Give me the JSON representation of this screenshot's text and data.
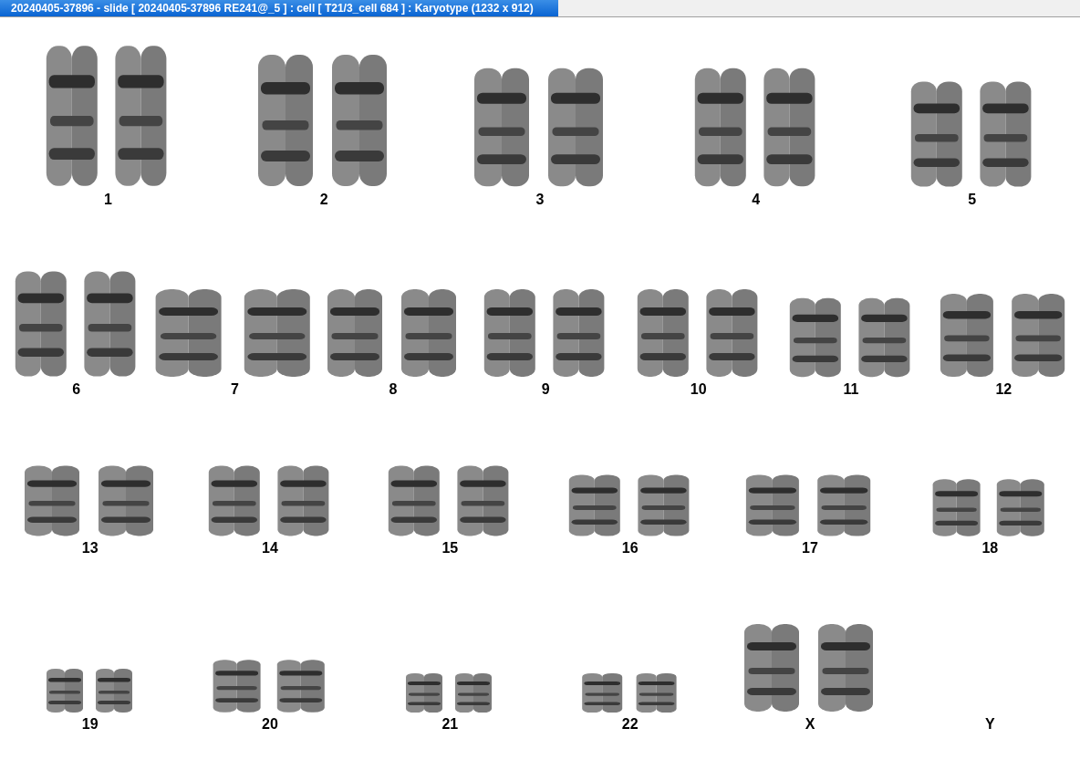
{
  "window": {
    "title": "20240405-37896 - slide [ 20240405-37896 RE241@_5 ] : cell [ T21/3_cell 684 ] : Karyotype  (1232 x 912)"
  },
  "karyotype_rows": [
    {
      "chromosomes": [
        {
          "label": "1",
          "kind": "pair"
        },
        {
          "label": "2",
          "kind": "pair"
        },
        {
          "label": "3",
          "kind": "pair"
        },
        {
          "label": "4",
          "kind": "pair"
        },
        {
          "label": "5",
          "kind": "pair"
        }
      ]
    },
    {
      "chromosomes": [
        {
          "label": "6",
          "kind": "pair"
        },
        {
          "label": "7",
          "kind": "pair"
        },
        {
          "label": "8",
          "kind": "pair"
        },
        {
          "label": "9",
          "kind": "pair"
        },
        {
          "label": "10",
          "kind": "pair"
        },
        {
          "label": "11",
          "kind": "pair"
        },
        {
          "label": "12",
          "kind": "pair"
        }
      ]
    },
    {
      "chromosomes": [
        {
          "label": "13",
          "kind": "pair"
        },
        {
          "label": "14",
          "kind": "pair"
        },
        {
          "label": "15",
          "kind": "pair"
        },
        {
          "label": "16",
          "kind": "pair"
        },
        {
          "label": "17",
          "kind": "pair"
        },
        {
          "label": "18",
          "kind": "pair"
        }
      ]
    },
    {
      "chromosomes": [
        {
          "label": "19",
          "kind": "pair"
        },
        {
          "label": "20",
          "kind": "pair"
        },
        {
          "label": "21",
          "kind": "pair"
        },
        {
          "label": "22",
          "kind": "pair"
        },
        {
          "label": "X",
          "kind": "pair"
        },
        {
          "label": "Y",
          "kind": "empty"
        }
      ]
    }
  ]
}
